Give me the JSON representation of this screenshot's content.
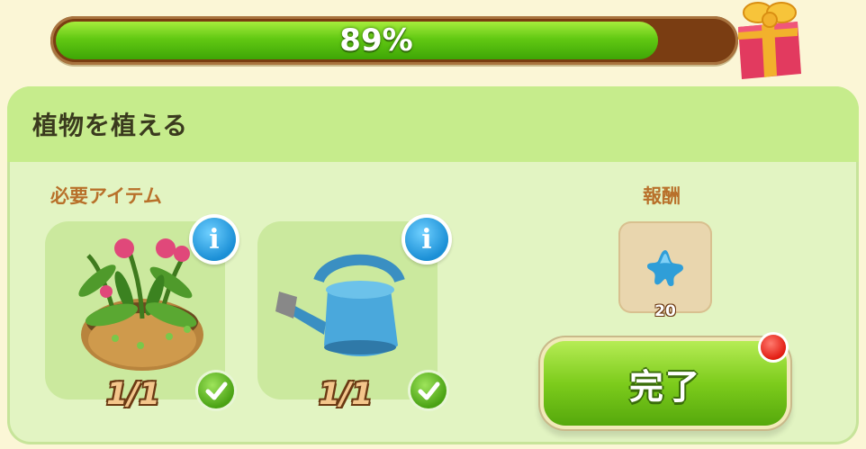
{
  "progress": {
    "percent_label": "89%",
    "fraction": 0.89
  },
  "task": {
    "title": "植物を植える",
    "required_label": "必要アイテム",
    "reward_label": "報酬",
    "items": [
      {
        "icon": "potted-peony-plant-icon",
        "count": "1/1",
        "complete": true
      },
      {
        "icon": "watering-can-icon",
        "count": "1/1",
        "complete": true
      }
    ],
    "reward": {
      "icon": "blue-star-icon",
      "amount": "20"
    },
    "complete_button": "完了"
  },
  "colors": {
    "progress_fill": "#62c913",
    "panel": "#e2f4c2",
    "header": "#c6ec8c",
    "button": "#7dcc1c",
    "accent_red": "#e21c12",
    "info_blue": "#1b8fd6"
  }
}
